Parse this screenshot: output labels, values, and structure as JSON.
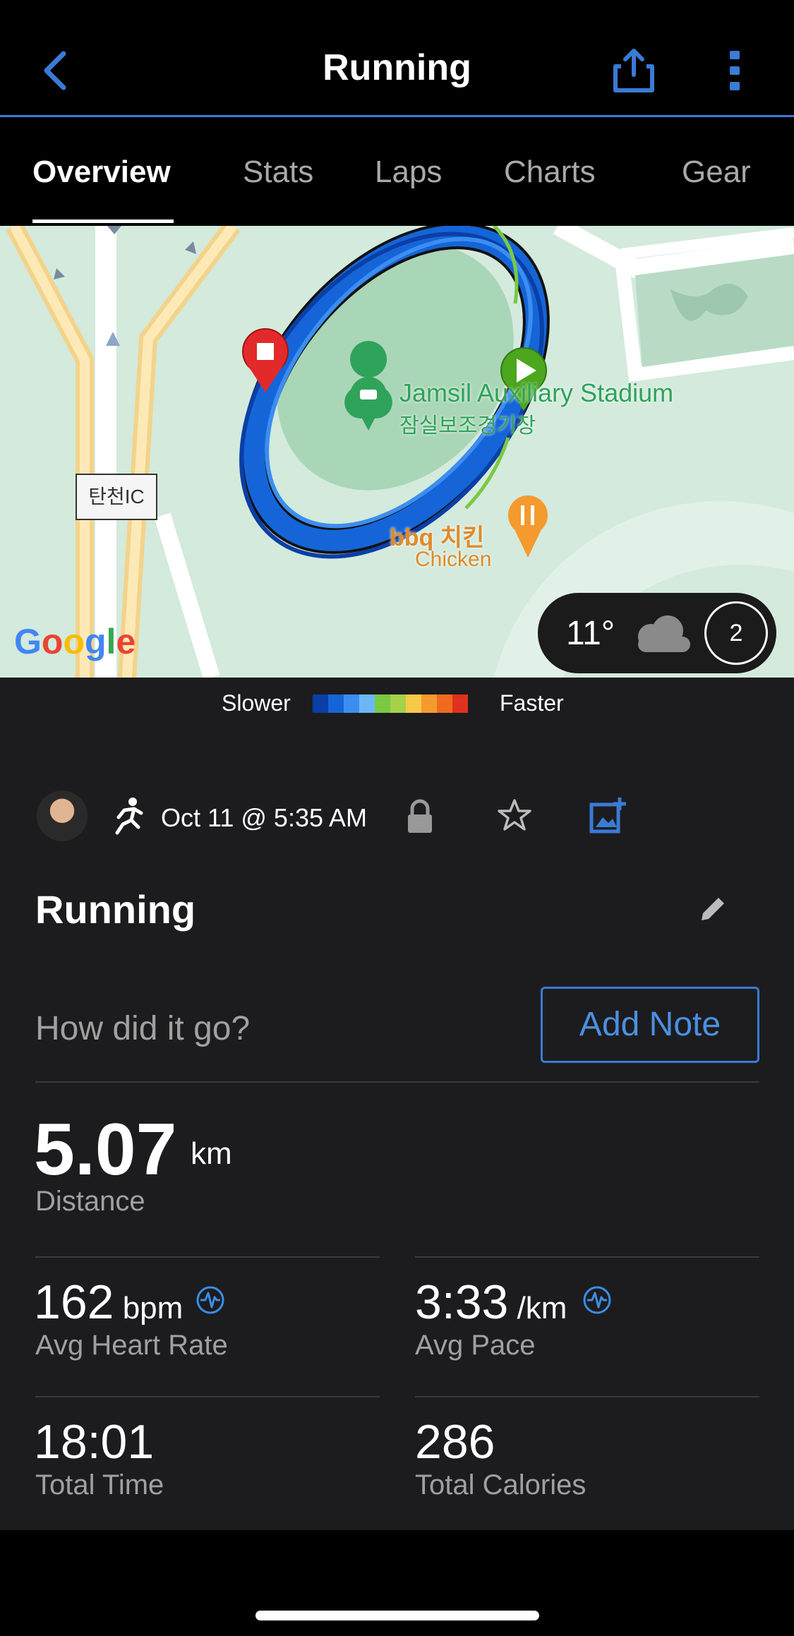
{
  "header": {
    "title": "Running",
    "icons": {
      "back": "chevron-left-icon",
      "share": "share-icon",
      "more": "more-vertical-icon"
    },
    "accent": "#3a7bd5"
  },
  "tabs": [
    {
      "label": "Overview",
      "active": true
    },
    {
      "label": "Stats",
      "active": false
    },
    {
      "label": "Laps",
      "active": false
    },
    {
      "label": "Charts",
      "active": false
    },
    {
      "label": "Gear",
      "active": false
    }
  ],
  "map": {
    "place_name": "Jamsil Auxiliary Stadium",
    "place_name_ko": "잠실보조경기장",
    "restaurant_name": "bbq 치킨",
    "restaurant_sub": "Chicken",
    "road_label": "탄천IC",
    "provider": "Google",
    "weather": {
      "temp": "11°",
      "icon": "cloud-icon",
      "lap_count": "2"
    }
  },
  "legend": {
    "slower": "Slower",
    "faster": "Faster",
    "colors": [
      "#0a3fa6",
      "#1565d8",
      "#3b8ef0",
      "#6bb8f5",
      "#7ac943",
      "#a4d24a",
      "#f7c948",
      "#f59a2e",
      "#ee6b1e",
      "#e0301e"
    ]
  },
  "activity": {
    "date": "Oct 11 @ 5:35 AM",
    "title": "Running",
    "note_placeholder": "How did it go?",
    "add_note": "Add Note"
  },
  "stats": {
    "distance": {
      "value": "5.07",
      "unit": "km",
      "label": "Distance"
    },
    "heart_rate": {
      "value": "162",
      "unit": " bpm",
      "label": "Avg Heart Rate"
    },
    "pace": {
      "value": "3:33",
      "unit": " /km",
      "label": "Avg Pace"
    },
    "time": {
      "value": "18:01",
      "label": "Total Time"
    },
    "calories": {
      "value": "286",
      "label": "Total Calories"
    }
  }
}
